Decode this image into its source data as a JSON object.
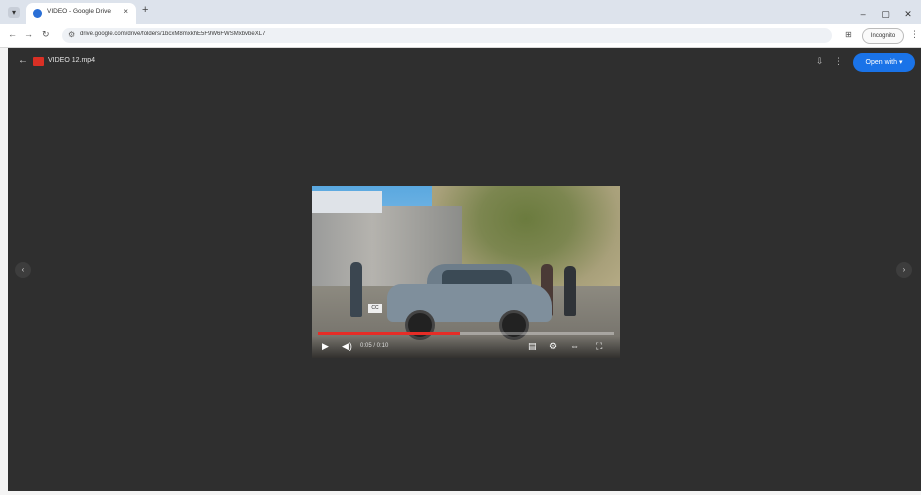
{
  "browser": {
    "tab_title": "VIDEO - Google Drive",
    "tab_close": "×",
    "new_tab": "+",
    "window_controls": [
      "–",
      "▢",
      "✕"
    ],
    "url": "drive.google.com/drive/folders/1bcxM8mxkhE5F9W6FWSMxbvbeXL7",
    "incognito_label": "Incognito",
    "more_label": "⋮"
  },
  "viewer": {
    "file_name": "VIDEO 12.mp4",
    "open_with_label": "Open with ▾",
    "header_icons": [
      "⇩",
      "⋮"
    ],
    "prev_arrow": "‹",
    "next_arrow": "›"
  },
  "player": {
    "progress": 0.48,
    "time_label": "0:05 / 0:10",
    "caption_chip": "CC",
    "colors": {
      "progress_played": "#e52d27",
      "accent": "#1a73e8"
    }
  }
}
